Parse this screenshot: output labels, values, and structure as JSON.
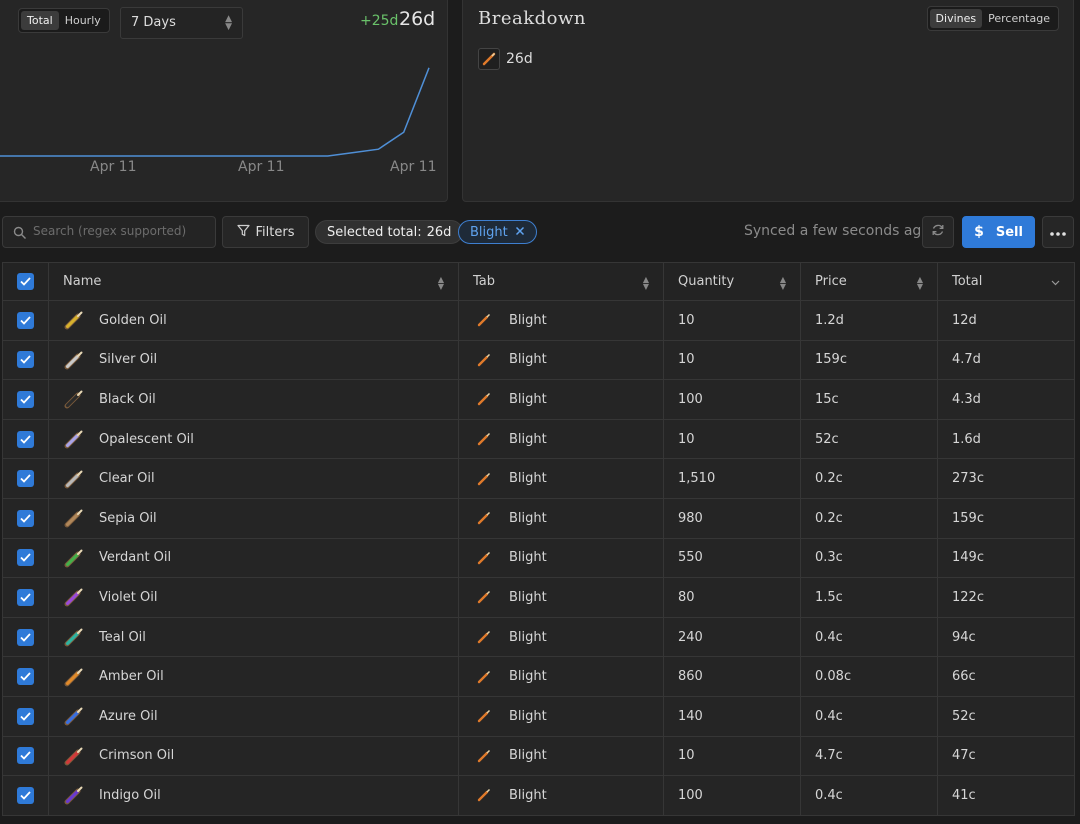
{
  "chart_panel": {
    "toggle": {
      "options": [
        "Total",
        "Hourly"
      ],
      "selected": "Total"
    },
    "range_select": {
      "value": "7 Days"
    },
    "delta": "+25d",
    "total": "26d",
    "x_ticks": [
      "Apr 11",
      "Apr 11",
      "Apr 11"
    ]
  },
  "chart_data": {
    "type": "line",
    "title": "",
    "series": [
      {
        "values": [
          0,
          0,
          0,
          0,
          0,
          0,
          0,
          0,
          0,
          0,
          0,
          0,
          0,
          0,
          1,
          2,
          7,
          26
        ]
      }
    ],
    "x_ticks": [
      "Apr 11",
      "Apr 11",
      "Apr 11"
    ],
    "ylim": [
      0,
      28
    ],
    "grid": false,
    "colors": {
      "line": "#4f8fd6"
    }
  },
  "breakdown": {
    "title": "Breakdown",
    "toggle": {
      "options": [
        "Divines",
        "Percentage"
      ],
      "selected": "Divines"
    },
    "item": {
      "icon": "blight-oil-icon",
      "value": "26d"
    }
  },
  "toolbar": {
    "search_placeholder": "Search (regex supported)",
    "filters_label": "Filters",
    "selected_total_label": "Selected total:",
    "selected_total_value": "26d",
    "tag_label": "Blight",
    "synced_text": "Synced a few seconds ago",
    "sell_label": "Sell"
  },
  "table": {
    "columns": [
      "Name",
      "Tab",
      "Quantity",
      "Price",
      "Total"
    ],
    "rows": [
      {
        "name": "Golden Oil",
        "tab": "Blight",
        "quantity": "10",
        "price": "1.2d",
        "total": "12d",
        "color": "#d7b12d"
      },
      {
        "name": "Silver Oil",
        "tab": "Blight",
        "quantity": "10",
        "price": "159c",
        "total": "4.7d",
        "color": "#c9c9c9"
      },
      {
        "name": "Black Oil",
        "tab": "Blight",
        "quantity": "100",
        "price": "15c",
        "total": "4.3d",
        "color": "#2b2b2b"
      },
      {
        "name": "Opalescent Oil",
        "tab": "Blight",
        "quantity": "10",
        "price": "52c",
        "total": "1.6d",
        "color": "#a9a4e8"
      },
      {
        "name": "Clear Oil",
        "tab": "Blight",
        "quantity": "1,510",
        "price": "0.2c",
        "total": "273c",
        "color": "#b8b8b8"
      },
      {
        "name": "Sepia Oil",
        "tab": "Blight",
        "quantity": "980",
        "price": "0.2c",
        "total": "159c",
        "color": "#b0875a"
      },
      {
        "name": "Verdant Oil",
        "tab": "Blight",
        "quantity": "550",
        "price": "0.3c",
        "total": "149c",
        "color": "#45b04a"
      },
      {
        "name": "Violet Oil",
        "tab": "Blight",
        "quantity": "80",
        "price": "1.5c",
        "total": "122c",
        "color": "#9a4ad8"
      },
      {
        "name": "Teal Oil",
        "tab": "Blight",
        "quantity": "240",
        "price": "0.4c",
        "total": "94c",
        "color": "#2fb3a0"
      },
      {
        "name": "Amber Oil",
        "tab": "Blight",
        "quantity": "860",
        "price": "0.08c",
        "total": "66c",
        "color": "#e08a2a"
      },
      {
        "name": "Azure Oil",
        "tab": "Blight",
        "quantity": "140",
        "price": "0.4c",
        "total": "52c",
        "color": "#3a6fe0"
      },
      {
        "name": "Crimson Oil",
        "tab": "Blight",
        "quantity": "10",
        "price": "4.7c",
        "total": "47c",
        "color": "#d23a3a"
      },
      {
        "name": "Indigo Oil",
        "tab": "Blight",
        "quantity": "100",
        "price": "0.4c",
        "total": "41c",
        "color": "#6a3ad0"
      }
    ]
  }
}
